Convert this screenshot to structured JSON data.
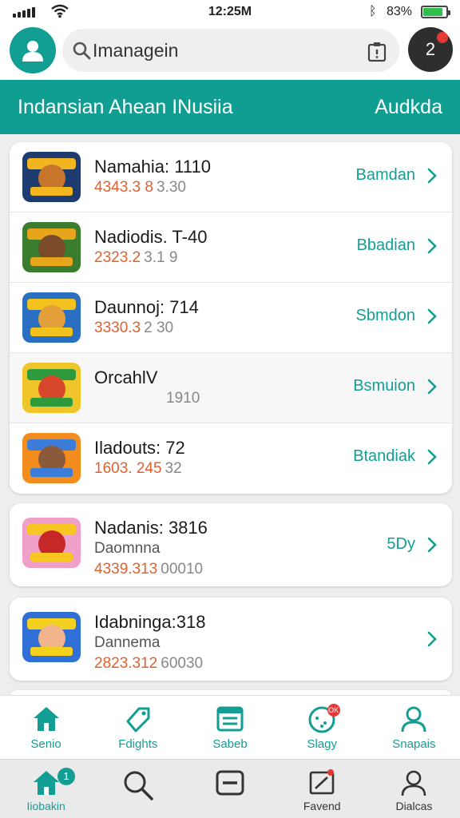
{
  "status_bar": {
    "time": "12:25M",
    "battery_percent_text": "83%",
    "battery_level": 0.83
  },
  "search": {
    "value": "Imanagein"
  },
  "notifications": {
    "count": "2"
  },
  "header": {
    "title": "Indansian Ahean INusiia",
    "action": "Audkda"
  },
  "list_main": [
    {
      "name": "Namahia: 1110",
      "line2": "",
      "stat_a": "4343.3 8",
      "stat_b": "3.30",
      "right_label": "Bamdan",
      "thumb_bg": "#1d3b6f",
      "thumb_face": "#c9762d",
      "thumb_band": "#f2b51f",
      "icon": "game-thumbnail-icon"
    },
    {
      "name": "Nadiodis. T-40",
      "line2": "",
      "stat_a": "2323.2",
      "stat_b": "3.1 9",
      "right_label": "Bbadian",
      "thumb_bg": "#3a7d2f",
      "thumb_face": "#7a4a2a",
      "thumb_band": "#e6a51a",
      "icon": "game-thumbnail-icon"
    },
    {
      "name": "Daunnoj: 714",
      "line2": "",
      "stat_a": "3330.3",
      "stat_b": "2 30",
      "right_label": "Sbmdon",
      "thumb_bg": "#2a6fc2",
      "thumb_face": "#e3a03a",
      "thumb_band": "#f4c21d",
      "icon": "game-thumbnail-icon"
    },
    {
      "name": "OrcahlV",
      "line2": "",
      "stat_a": "",
      "stat_b": "1910",
      "right_label": "Bsmuion",
      "thumb_bg": "#f0c52a",
      "thumb_face": "#d9472b",
      "thumb_band": "#2e9a3b",
      "icon": "game-thumbnail-icon"
    },
    {
      "name": "Iladouts: 72",
      "line2": "",
      "stat_a": "1603. 245",
      "stat_b": "32",
      "right_label": "Btandiak",
      "thumb_bg": "#f28c1c",
      "thumb_face": "#8a5a3a",
      "thumb_band": "#3b7dd8",
      "icon": "game-thumbnail-icon"
    }
  ],
  "list_extra": [
    {
      "name": "Nadanis: 3816",
      "line2": "Daomnna",
      "stat_a": "4339.313",
      "stat_b": "00010",
      "right_label": "5Dy",
      "thumb_bg": "#ef9fc8",
      "thumb_face": "#c62828",
      "thumb_band": "#f7c623",
      "icon": "game-thumbnail-icon"
    },
    {
      "name": "Idabninga:318",
      "line2": "Dannema",
      "stat_a": "2823.312",
      "stat_b": "60030",
      "right_label": "",
      "thumb_bg": "#2f6fd6",
      "thumb_face": "#f2b48a",
      "thumb_band": "#f4d11f",
      "icon": "game-thumbnail-icon"
    }
  ],
  "tabs_primary": [
    {
      "label": "Senio",
      "icon": "home-icon"
    },
    {
      "label": "Fdights",
      "icon": "tag-icon"
    },
    {
      "label": "Sabeb",
      "icon": "list-icon"
    },
    {
      "label": "Slagy",
      "icon": "face-icon",
      "badge": "OK"
    },
    {
      "label": "Snapais",
      "icon": "profile-icon"
    }
  ],
  "tabs_secondary": [
    {
      "label": "Iiobakin",
      "icon": "home-icon",
      "badge": "1"
    },
    {
      "label": "",
      "icon": "search-icon"
    },
    {
      "label": "",
      "icon": "card-icon"
    },
    {
      "label": "Favend",
      "icon": "note-icon"
    },
    {
      "label": "Dialcas",
      "icon": "profile-icon"
    }
  ],
  "colors": {
    "accent": "#109e93",
    "orange_stat": "#e0612f",
    "badge_red": "#e53935"
  }
}
